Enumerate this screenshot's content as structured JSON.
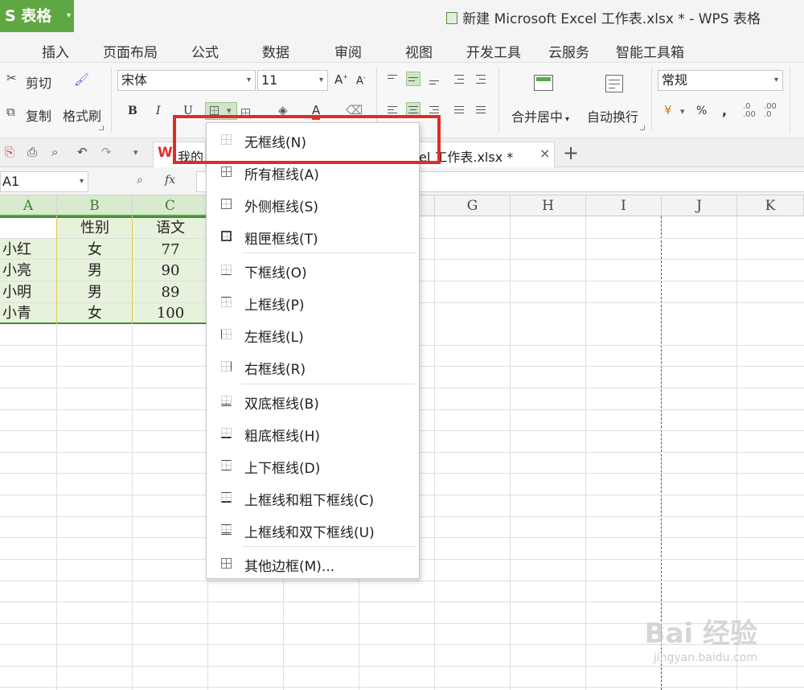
{
  "app": {
    "name": "S 表格",
    "dropdown": "▾"
  },
  "window": {
    "title": "新建 Microsoft Excel 工作表.xlsx * - WPS 表格"
  },
  "menu": [
    "插入",
    "页面布局",
    "公式",
    "数据",
    "审阅",
    "视图",
    "开发工具",
    "云服务",
    "智能工具箱"
  ],
  "ribbon": {
    "cut": "剪切",
    "copy": "复制",
    "format_painter": "格式刷",
    "font_name": "宋体",
    "font_size": "11",
    "bold": "B",
    "italic": "I",
    "underline": "U",
    "merge_center": "合并居中",
    "wrap_text": "自动换行",
    "number_format": "常规",
    "percent": "%",
    "comma": ",",
    "font_grow": "A",
    "font_shrink": "A",
    "font_color": "A"
  },
  "doc_tabs": {
    "left_label": "我的",
    "right_label": "el 工作表.xlsx *",
    "close": "×",
    "add": "+"
  },
  "formula_bar": {
    "cell_ref": "A1",
    "fx": "fx"
  },
  "grid": {
    "columns": [
      "A",
      "B",
      "C",
      "G",
      "H",
      "I",
      "J",
      "K"
    ],
    "rows": [
      [
        "",
        "性别",
        "语文"
      ],
      [
        "小红",
        "女",
        "77"
      ],
      [
        "小亮",
        "男",
        "90"
      ],
      [
        "小明",
        "男",
        "89"
      ],
      [
        "小青",
        "女",
        "100"
      ]
    ]
  },
  "border_menu": {
    "items": [
      "无框线(N)",
      "所有框线(A)",
      "外侧框线(S)",
      "粗匣框线(T)",
      "下框线(O)",
      "上框线(P)",
      "左框线(L)",
      "右框线(R)",
      "双底框线(B)",
      "粗底框线(H)",
      "上下框线(D)",
      "上框线和粗下框线(C)",
      "上框线和双下框线(U)",
      "其他边框(M)..."
    ]
  },
  "watermark": {
    "main": "Bai 经验",
    "sub": "jingyan.baidu.com"
  },
  "colors": {
    "accent": "#5fa742",
    "highlight": "#e02b2b",
    "selection": "#e7f2dc"
  }
}
